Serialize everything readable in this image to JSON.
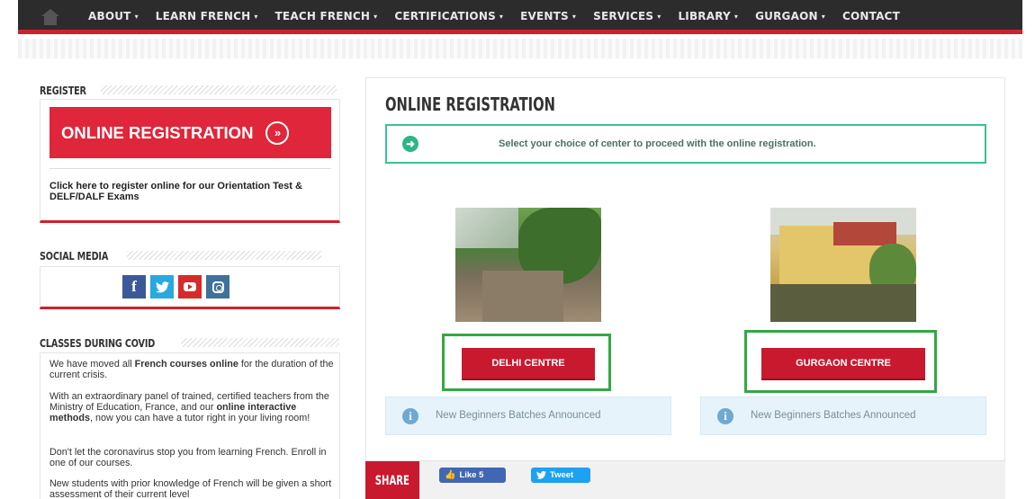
{
  "nav": {
    "items": [
      {
        "label": "ABOUT",
        "has_caret": true
      },
      {
        "label": "LEARN FRENCH",
        "has_caret": true
      },
      {
        "label": "TEACH FRENCH",
        "has_caret": true
      },
      {
        "label": "CERTIFICATIONS",
        "has_caret": true
      },
      {
        "label": "EVENTS",
        "has_caret": true
      },
      {
        "label": "SERVICES",
        "has_caret": true
      },
      {
        "label": "LIBRARY",
        "has_caret": true
      },
      {
        "label": "GURGAON",
        "has_caret": true
      },
      {
        "label": "CONTACT",
        "has_caret": false
      }
    ],
    "caret": "▾",
    "home_icon": "home-icon"
  },
  "sidebar": {
    "register": {
      "heading": "REGISTER",
      "button_label": "ONLINE REGISTRATION",
      "button_arrow": "»",
      "description": "Click here to register online for our Orientation Test & DELF/DALF Exams"
    },
    "social": {
      "heading": "SOCIAL MEDIA",
      "icons": [
        {
          "name": "facebook-icon",
          "glyph": "f",
          "color": "#3b5998"
        },
        {
          "name": "twitter-icon",
          "glyph": "🐦",
          "color": "#28a9e0"
        },
        {
          "name": "youtube-icon",
          "glyph": "",
          "color": "#d72a2a"
        },
        {
          "name": "instagram-icon",
          "glyph": "",
          "color": "#3f729b"
        }
      ]
    },
    "covid": {
      "heading": "CLASSES DURING COVID",
      "p1_pre": "We have moved all ",
      "p1_bold": "French courses online",
      "p1_post": " for the duration of the current crisis.",
      "p2_pre": "With an extraordinary panel of trained, certified teachers from the Ministry of Education, France, and our ",
      "p2_bold": "online interactive methods",
      "p2_post": ", now you can have a tutor right in your living room!",
      "p3": "Don't let the coronavirus stop you from learning French. Enroll in one of our courses.",
      "p4": "New students with prior knowledge of French will be given a short assessment of their current level"
    }
  },
  "main": {
    "title": "ONLINE REGISTRATION",
    "info_message": "Select your choice of center to proceed with the online registration.",
    "info_icon": "arrow-circle-right-icon",
    "centres": [
      {
        "button_label": "DELHI CENTRE",
        "note": "New Beginners Batches Announced"
      },
      {
        "button_label": "GURGAON CENTRE",
        "note": "New Beginners Batches Announced"
      }
    ],
    "share": {
      "label": "SHARE",
      "like_label": "Like 5",
      "tweet_label": "Tweet"
    }
  },
  "colors": {
    "accent_red": "#d0202e",
    "button_red": "#c9192f",
    "highlight_green": "#33a845",
    "info_teal": "#3cbf97",
    "nav_dark": "#2c2c2c"
  }
}
